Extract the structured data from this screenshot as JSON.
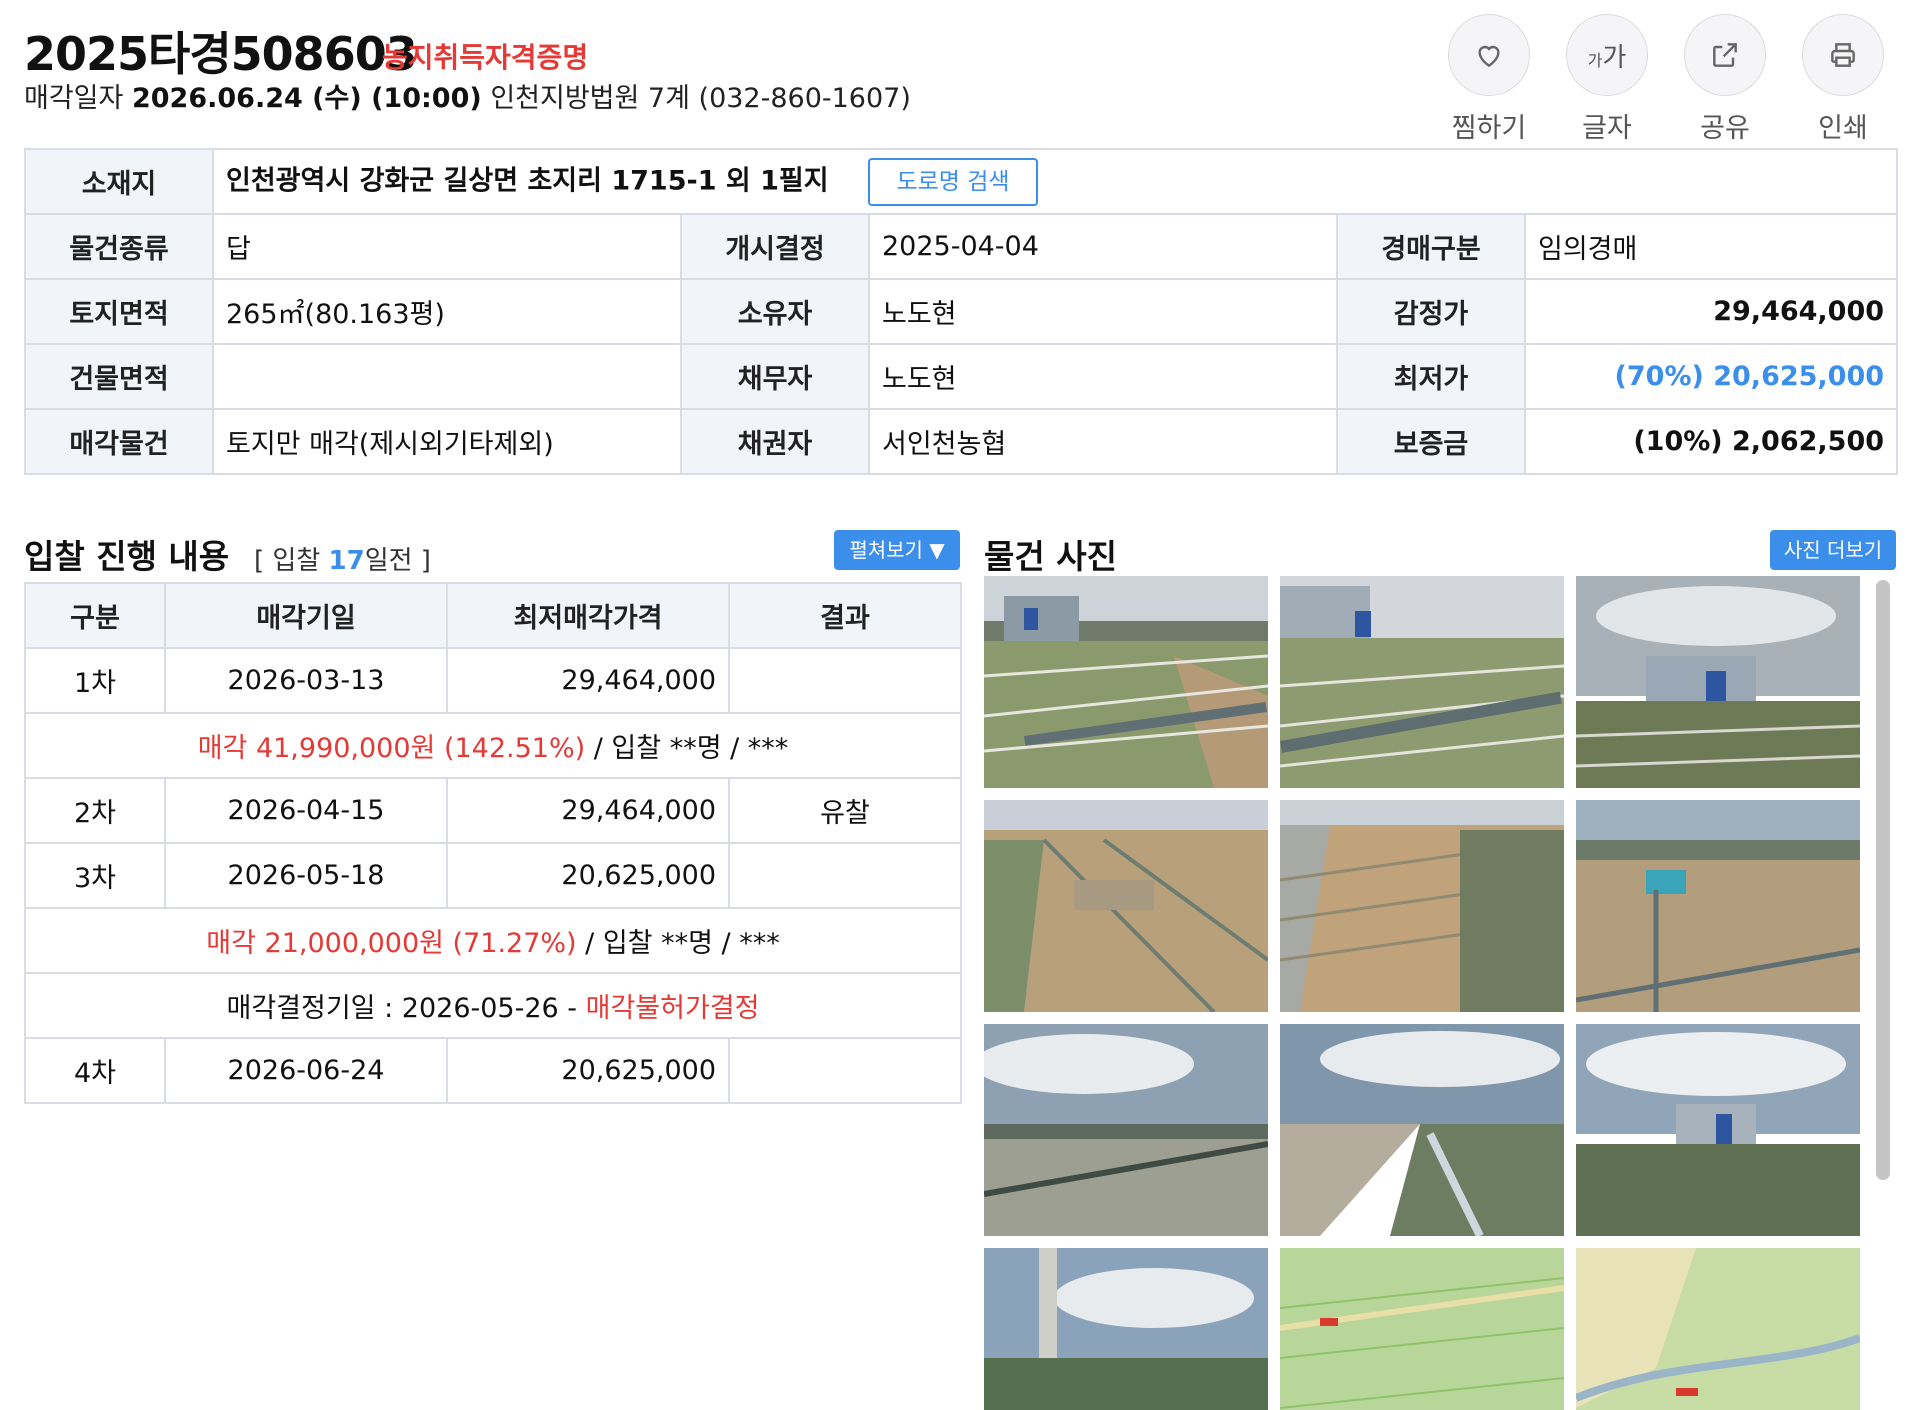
{
  "header": {
    "case_number": "2025타경508603",
    "badge": "농지취득자격증명",
    "sale_prefix": "매각일자",
    "sale_date": "2026.06.24 (수) (10:00)",
    "court": "인천지방법원 7계 (032-860-1607)"
  },
  "actions": [
    {
      "label": "찜하기",
      "icon": "heart-icon"
    },
    {
      "label": "글자",
      "icon": "font-size-icon",
      "glyph_small": "가",
      "glyph_big": "가"
    },
    {
      "label": "공유",
      "icon": "share-icon"
    },
    {
      "label": "인쇄",
      "icon": "print-icon"
    }
  ],
  "info": {
    "location_label": "소재지",
    "location": "인천광역시 강화군 길상면 초지리 1715-1 외 1필지",
    "road_button": "도로명 검색",
    "rows": [
      [
        "물건종류",
        "답",
        "개시결정",
        "2025-04-04",
        "경매구분",
        "임의경매"
      ],
      [
        "토지면적",
        "265㎡(80.163평)",
        "소유자",
        "노도현",
        "감정가",
        "29,464,000"
      ],
      [
        "건물면적",
        "",
        "채무자",
        "노도현",
        "최저가",
        "(70%) 20,625,000"
      ],
      [
        "매각물건",
        "토지만 매각(제시외기타제외)",
        "채권자",
        "서인천농협",
        "보증금",
        "(10%) 2,062,500"
      ]
    ]
  },
  "bid": {
    "title": "입찰 진행 내용",
    "sub_prefix": "[ 입찰",
    "days": "17",
    "sub_suffix": "일전 ]",
    "expand_button": "펼쳐보기 ▼",
    "columns": [
      "구분",
      "매각기일",
      "최저매각가격",
      "결과"
    ],
    "rounds": [
      {
        "round": "1차",
        "date": "2026-03-13",
        "price": "29,464,000",
        "result": ""
      },
      {
        "round": "2차",
        "date": "2026-04-15",
        "price": "29,464,000",
        "result": "유찰"
      },
      {
        "round": "3차",
        "date": "2026-05-18",
        "price": "20,625,000",
        "result": ""
      },
      {
        "round": "4차",
        "date": "2026-06-24",
        "price": "20,625,000",
        "result": ""
      }
    ],
    "sale1": {
      "red": "매각 41,990,000원 (142.51%)",
      "rest": " / 입찰 **명 / ***"
    },
    "sale3": {
      "red": "매각 21,000,000원 (71.27%)",
      "rest": " / 입찰 **명 / ***"
    },
    "decision": {
      "text": "매각결정기일 : 2026-05-26 - ",
      "red": "매각불허가결정"
    }
  },
  "photos": {
    "title": "물건 사진",
    "more_button": "사진 더보기"
  }
}
